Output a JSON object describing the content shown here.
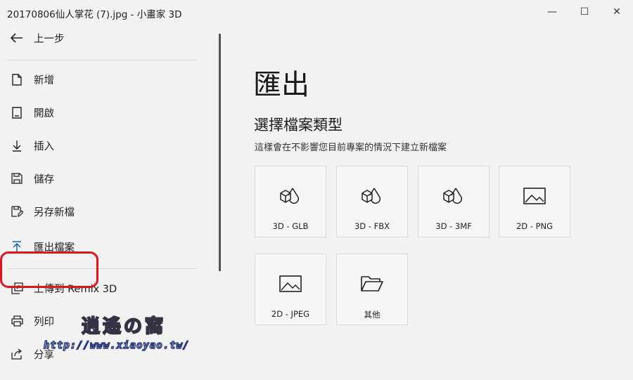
{
  "window": {
    "title": "20170806仙人掌花 (7).jpg - 小畫家 3D",
    "minimize_glyph": "—",
    "maximize_glyph": "☐",
    "close_glyph": "✕"
  },
  "sidebar": {
    "back_label": "上一步",
    "items": [
      {
        "label": "新增",
        "icon": "new-file-icon"
      },
      {
        "label": "開啟",
        "icon": "open-file-icon"
      },
      {
        "label": "插入",
        "icon": "insert-icon"
      },
      {
        "label": "儲存",
        "icon": "save-icon"
      },
      {
        "label": "另存新檔",
        "icon": "save-as-icon"
      },
      {
        "label": "匯出檔案",
        "icon": "export-icon"
      },
      {
        "label": "上傳到 Remix 3D",
        "icon": "upload-icon"
      },
      {
        "label": "列印",
        "icon": "print-icon"
      },
      {
        "label": "分享",
        "icon": "share-icon"
      }
    ],
    "selected": "匯出檔案"
  },
  "main": {
    "title": "匯出",
    "section_title": "選擇檔案類型",
    "description": "這樣會在不影響您目前專案的情況下建立新檔案",
    "file_types": [
      {
        "label": "3D - GLB",
        "icon": "3d-shapes-icon"
      },
      {
        "label": "3D - FBX",
        "icon": "3d-shapes-icon"
      },
      {
        "label": "3D - 3MF",
        "icon": "3d-shapes-icon"
      },
      {
        "label": "2D - PNG",
        "icon": "image-icon"
      },
      {
        "label": "2D - JPEG",
        "icon": "image-icon"
      },
      {
        "label": "其他",
        "icon": "folder-icon"
      }
    ]
  },
  "watermark": {
    "title": "逍遙の窩",
    "url": "http://www.xiaoyao.tw/"
  },
  "colors": {
    "background": "#f2f2f2",
    "highlight": "#e0141e",
    "accent_blue": "#0063b1"
  }
}
